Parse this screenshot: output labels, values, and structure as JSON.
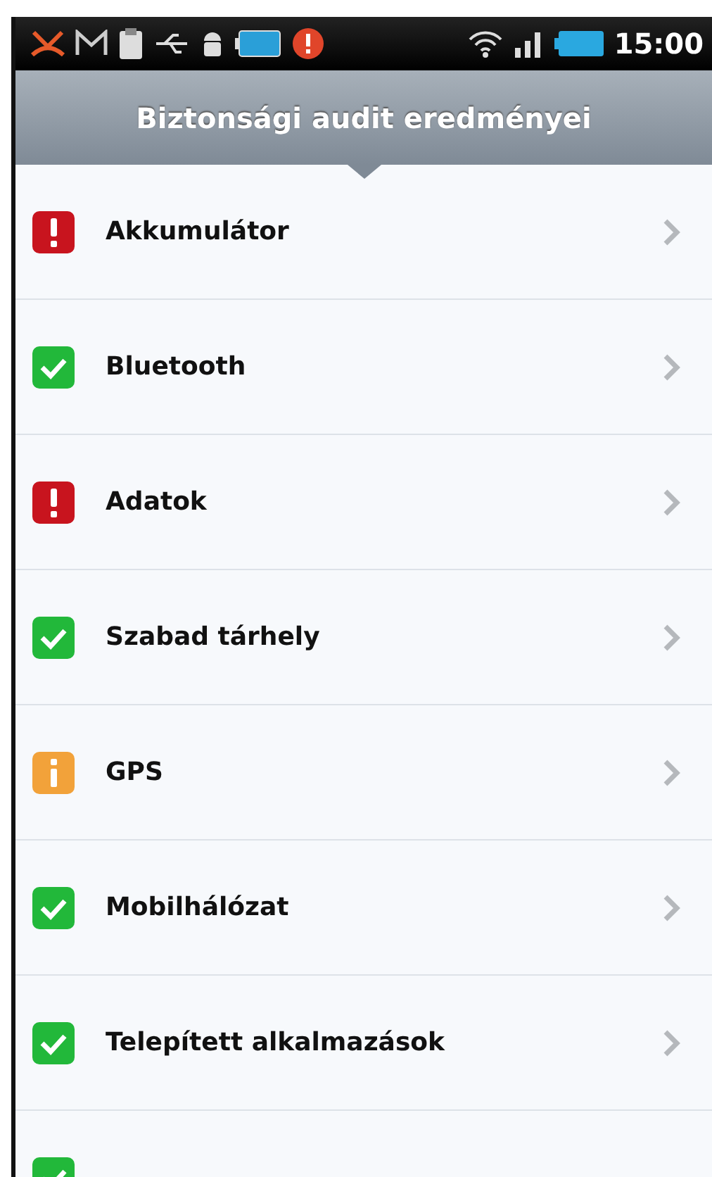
{
  "status_bar": {
    "time": "15:00"
  },
  "title": "Biztonsági audit eredményei",
  "items": [
    {
      "label": "Akkumulátor",
      "kind": "error"
    },
    {
      "label": "Bluetooth",
      "kind": "ok"
    },
    {
      "label": "Adatok",
      "kind": "error"
    },
    {
      "label": "Szabad tárhely",
      "kind": "ok"
    },
    {
      "label": "GPS",
      "kind": "info"
    },
    {
      "label": "Mobilhálózat",
      "kind": "ok"
    },
    {
      "label": "Telepített alkalmazások",
      "kind": "ok"
    },
    {
      "kind": "ok"
    }
  ]
}
